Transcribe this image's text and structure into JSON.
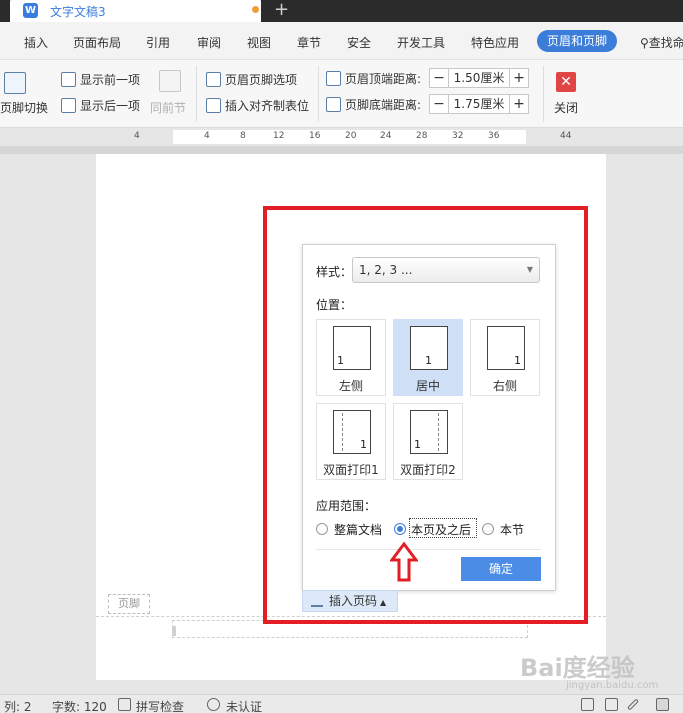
{
  "window": {
    "tab_title": "文字文稿3",
    "app_icon": "W"
  },
  "menu": {
    "items": [
      "插入",
      "页面布局",
      "引用",
      "审阅",
      "视图",
      "章节",
      "安全",
      "开发工具",
      "特色应用",
      "页眉和页脚"
    ],
    "active": "页眉和页脚",
    "search_label": "查找命"
  },
  "toolbar": {
    "switch_label": "页脚切换",
    "prev_label": "显示前一项",
    "next_label": "显示后一项",
    "same_section_label": "同前节",
    "options_label": "页眉页脚选项",
    "align_tab_label": "插入对齐制表位",
    "header_distance_label": "页眉顶端距离:",
    "header_distance_value": "1.50厘米",
    "footer_distance_label": "页脚底端距离:",
    "footer_distance_value": "1.75厘米",
    "close_label": "关闭",
    "minus": "−",
    "plus": "+"
  },
  "ruler": {
    "ticks": [
      "4",
      "4",
      "8",
      "12",
      "16",
      "20",
      "24",
      "28",
      "32",
      "36",
      "44"
    ]
  },
  "dialog": {
    "style_label": "样式：",
    "style_value": "1, 2, 3 ...",
    "position_label": "位置：",
    "positions": [
      {
        "label": "左侧",
        "num": "1",
        "selected": false
      },
      {
        "label": "居中",
        "num": "1",
        "selected": true
      },
      {
        "label": "右侧",
        "num": "1",
        "selected": false
      },
      {
        "label": "双面打印1",
        "num": "1",
        "selected": false
      },
      {
        "label": "双面打印2",
        "num": "1",
        "selected": false
      }
    ],
    "scope_label": "应用范围：",
    "scope_options": [
      {
        "label": "整篇文档",
        "checked": false
      },
      {
        "label": "本页及之后",
        "checked": true
      },
      {
        "label": "本节",
        "checked": false
      }
    ],
    "ok_label": "确定"
  },
  "page": {
    "footer_tag": "页脚",
    "insert_page_number_label": "插入页码"
  },
  "status": {
    "column": "列: 2",
    "word_count": "字数: 120",
    "spell_check": "拼写检查",
    "auth": "未认证"
  },
  "watermark": {
    "text": "Bai度经验",
    "sub": "jingyan.baidu.com"
  },
  "colors": {
    "accent": "#3d7dda",
    "annotation_red": "#e31e24",
    "ok_button": "#4b8de6",
    "selected_cell": "#cfe0f6"
  }
}
